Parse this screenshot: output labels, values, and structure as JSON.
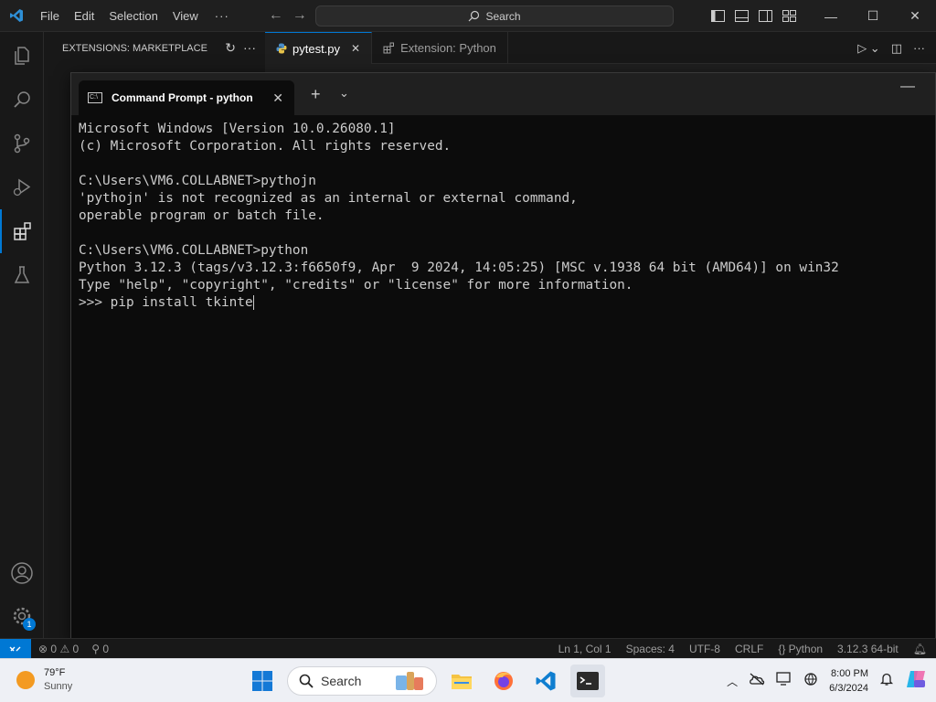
{
  "titlebar": {
    "menu": [
      "File",
      "Edit",
      "Selection",
      "View"
    ],
    "more": "···",
    "search_placeholder": "Search"
  },
  "sidebar": {
    "title": "EXTENSIONS: MARKETPLACE"
  },
  "editor": {
    "tabs": [
      {
        "label": "pytest.py",
        "active": true
      },
      {
        "label": "Extension: Python",
        "active": false
      }
    ]
  },
  "terminal": {
    "tab_title": "Command Prompt - python",
    "lines": [
      "Microsoft Windows [Version 10.0.26080.1]",
      "(c) Microsoft Corporation. All rights reserved.",
      "",
      "C:\\Users\\VM6.COLLABNET>pythojn",
      "'pythojn' is not recognized as an internal or external command,",
      "operable program or batch file.",
      "",
      "C:\\Users\\VM6.COLLABNET>python",
      "Python 3.12.3 (tags/v3.12.3:f6650f9, Apr  9 2024, 14:05:25) [MSC v.1938 64 bit (AMD64)] on win32",
      "Type \"help\", \"copyright\", \"credits\" or \"license\" for more information.",
      ">>> pip install tkinte"
    ]
  },
  "statusbar": {
    "errors": "0",
    "warnings": "0",
    "ports": "0",
    "right_items": [
      "Ln 1, Col 1",
      "Spaces: 4",
      "UTF-8",
      "CRLF",
      "{} Python",
      "3.12.3 64-bit"
    ]
  },
  "activitybar": {
    "settings_badge": "1"
  },
  "taskbar": {
    "weather_temp": "79°F",
    "weather_cond": "Sunny",
    "search_label": "Search",
    "time": "8:00 PM",
    "date": "6/3/2024"
  },
  "colors": {
    "accent": "#0078d4",
    "terminal_bg": "#0c0c0c",
    "taskbar_bg": "#eef0f5"
  }
}
